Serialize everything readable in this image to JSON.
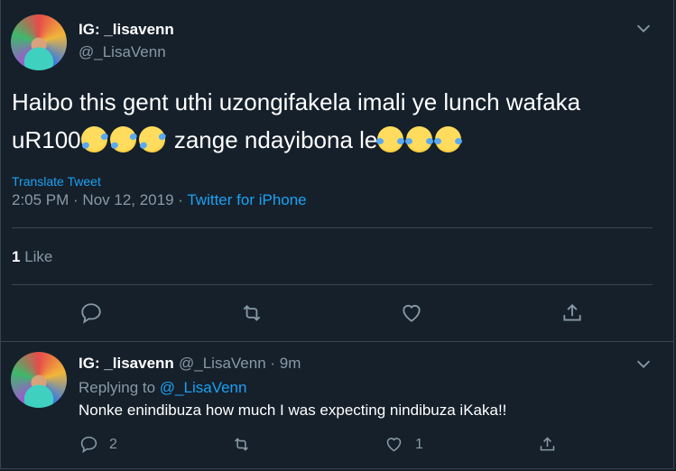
{
  "main_tweet": {
    "display_name": "IG: _lisavenn",
    "handle": "@_LisaVenn",
    "text_line1": "Haibo this gent uthi uzongifakela imali ye lunch wafaka",
    "text_line2_a": "uR100",
    "text_line2_b": " zange ndayibona le",
    "translate_label": "Translate Tweet",
    "timestamp": "2:05 PM · Nov 12, 2019 · ",
    "source": "Twitter for iPhone",
    "like_count": "1",
    "like_label": " Like"
  },
  "reply_tweet": {
    "display_name": "IG: _lisavenn",
    "handle_time": " @_LisaVenn · 9m",
    "replying_to_label": "Replying to ",
    "replying_to_handle": "@_LisaVenn",
    "text": "Nonke enindibuza how much I was expecting nindibuza iKaka!!",
    "reply_count": "2",
    "like_count": "1"
  },
  "icons": [
    "chevron-down-icon",
    "reply-icon",
    "retweet-icon",
    "like-icon",
    "share-icon",
    "rofl-emoji",
    "tears-of-joy-emoji"
  ],
  "colors": {
    "background": "#15202b",
    "accent": "#1da1f2",
    "muted": "#8899a6",
    "border": "#38444d"
  }
}
